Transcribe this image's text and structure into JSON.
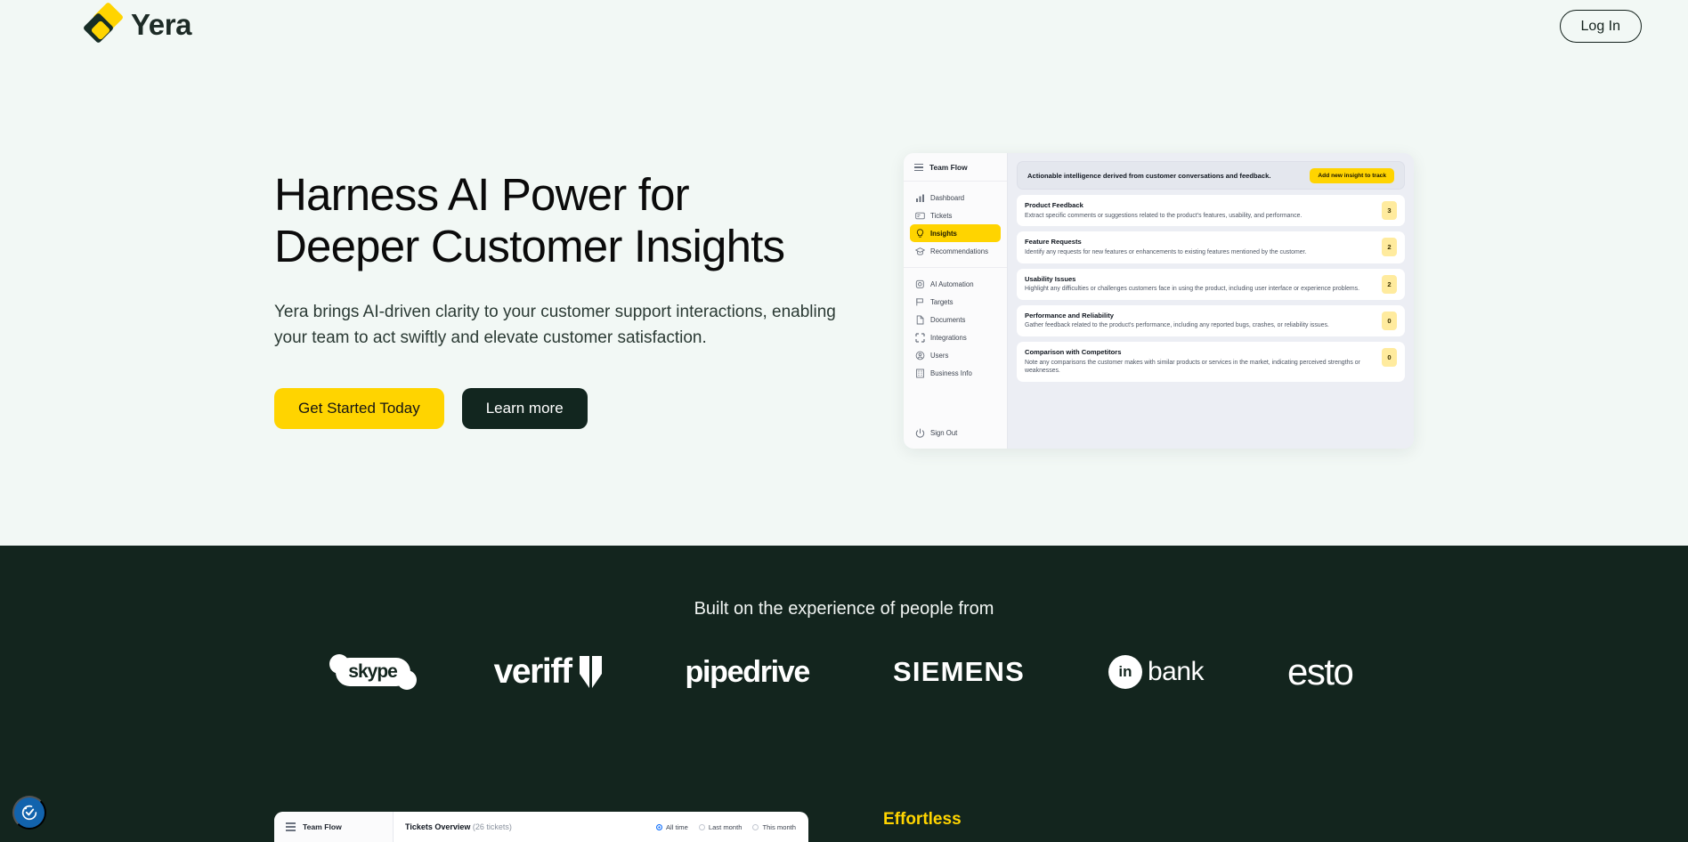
{
  "brand": {
    "name": "Yera",
    "logo_icon": "yera-diamond-logo"
  },
  "nav": {
    "login_label": "Log In"
  },
  "hero": {
    "title_line1": "Harness AI Power for",
    "title_line2": "Deeper Customer Insights",
    "subtitle": "Yera brings AI-driven clarity to your customer support interactions, enabling your team to act swiftly and elevate customer satisfaction.",
    "cta_primary": "Get Started Today",
    "cta_secondary": "Learn more",
    "accent_yellow": "#ffd400",
    "dark_green": "#12261f"
  },
  "mockup": {
    "sidebar": {
      "brand": "Team Flow",
      "menu_icon": "hamburger-icon",
      "groups": [
        [
          {
            "label": "Dashboard",
            "icon": "bar-chart-icon",
            "active": false
          },
          {
            "label": "Tickets",
            "icon": "ticket-icon",
            "active": false
          },
          {
            "label": "Insights",
            "icon": "lightbulb-icon",
            "active": true
          },
          {
            "label": "Recommendations",
            "icon": "graduation-icon",
            "active": false
          }
        ],
        [
          {
            "label": "AI Automation",
            "icon": "robot-icon",
            "active": false
          },
          {
            "label": "Targets",
            "icon": "flag-icon",
            "active": false
          },
          {
            "label": "Documents",
            "icon": "document-icon",
            "active": false
          },
          {
            "label": "Integrations",
            "icon": "integrations-icon",
            "active": false
          },
          {
            "label": "Users",
            "icon": "user-circle-icon",
            "active": false
          },
          {
            "label": "Business Info",
            "icon": "building-icon",
            "active": false
          }
        ],
        [
          {
            "label": "Sign Out",
            "icon": "sign-out-icon",
            "active": false
          }
        ]
      ]
    },
    "banner": {
      "text": "Actionable intelligence derived from customer conversations and feedback.",
      "button": "Add new insight to track"
    },
    "insights": [
      {
        "title": "Product Feedback",
        "description": "Extract specific comments or suggestions related to the product's features, usability, and performance.",
        "count": "3"
      },
      {
        "title": "Feature Requests",
        "description": "Identify any requests for new features or enhancements to existing features mentioned by the customer.",
        "count": "2"
      },
      {
        "title": "Usability Issues",
        "description": "Highlight any difficulties or challenges customers face in using the product, including user interface or experience problems.",
        "count": "2"
      },
      {
        "title": "Performance and Reliability",
        "description": "Gather feedback related to the product's performance, including any reported bugs, crashes, or reliability issues.",
        "count": "0"
      },
      {
        "title": "Comparison with Competitors",
        "description": "Note any comparisons the customer makes with similar products or services in the market, indicating perceived strengths or weaknesses.",
        "count": "0"
      }
    ]
  },
  "social_proof": {
    "heading": "Built on the experience of people from",
    "logos": [
      {
        "name": "skype",
        "text": "skype"
      },
      {
        "name": "veriff",
        "text": "veriff"
      },
      {
        "name": "pipedrive",
        "text": "pipedrive"
      },
      {
        "name": "siemens",
        "text": "SIEMENS"
      },
      {
        "name": "inbank",
        "text": "bank",
        "mark": "in"
      },
      {
        "name": "esto",
        "text": "esto"
      }
    ]
  },
  "bottom_mockup": {
    "sidebar_brand": "Team Flow",
    "title": "Tickets Overview",
    "count": "(26 tickets)",
    "filters": [
      {
        "label": "All time",
        "selected": true
      },
      {
        "label": "Last month",
        "selected": false
      },
      {
        "label": "This month",
        "selected": false
      }
    ],
    "section_label": "Effortless"
  },
  "widgets": {
    "accessibility_icon": "accessibility-check-icon"
  }
}
